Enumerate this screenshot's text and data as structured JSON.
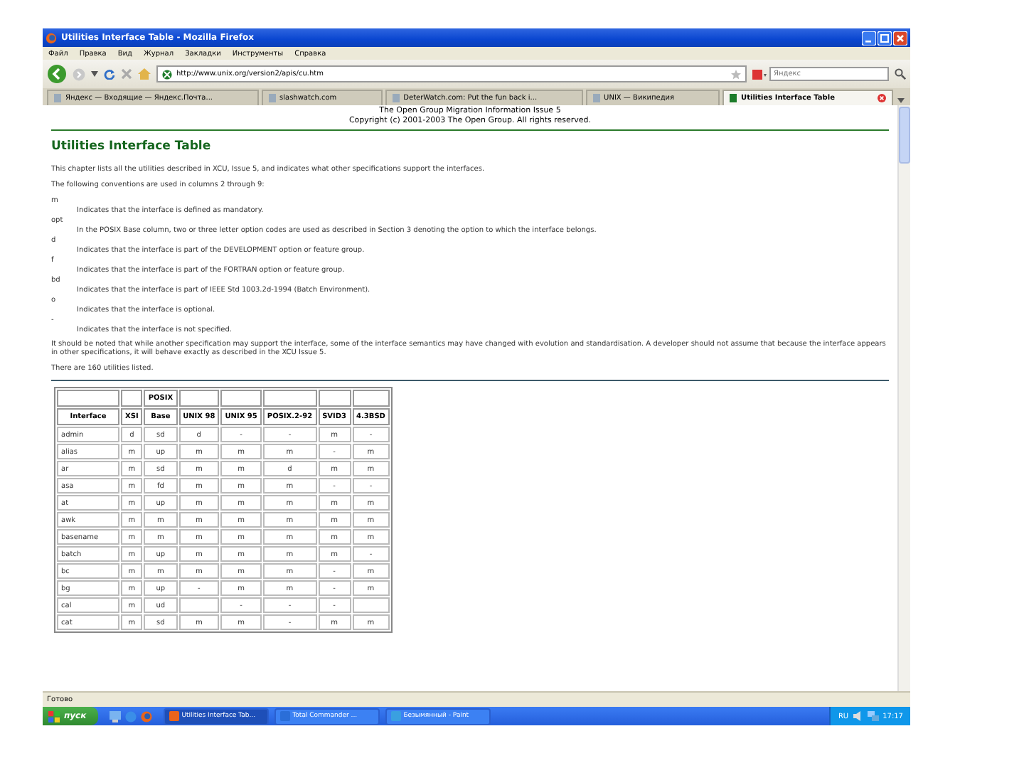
{
  "window": {
    "title": "Utilities Interface Table - Mozilla Firefox"
  },
  "menu": [
    "Файл",
    "Правка",
    "Вид",
    "Журнал",
    "Закладки",
    "Инструменты",
    "Справка"
  ],
  "toolbar": {
    "url": "http://www.unix.org/version2/apis/cu.htm",
    "search_placeholder": "Яндекс"
  },
  "tabs": [
    {
      "label": "Яндекс — Входящие — Яндекс.Почта...",
      "selected": false
    },
    {
      "label": "slashwatch.com",
      "selected": false
    },
    {
      "label": "DeterWatch.com: Put the fun back i...",
      "selected": false
    },
    {
      "label": "UNIX — Википедия",
      "selected": false
    },
    {
      "label": "Utilities Interface Table",
      "selected": true
    }
  ],
  "page": {
    "header": [
      "The Open Group Migration Information Issue 5",
      "Copyright (c) 2001-2003 The Open Group. All rights reserved."
    ],
    "heading": "Utilities Interface Table",
    "intro": [
      "This chapter lists all the utilities described in XCU, Issue 5, and indicates what other specifications support the interfaces.",
      "The following conventions are used in columns 2 through 9:"
    ],
    "conventions": [
      {
        "code": "m",
        "text": "Indicates that the interface is defined as mandatory."
      },
      {
        "code": "opt",
        "text": "In the POSIX Base column, two or three letter option codes are used as described in Section 3 denoting the option to which the interface belongs."
      },
      {
        "code": "d",
        "text": "Indicates that the interface is part of the DEVELOPMENT option or feature group."
      },
      {
        "code": "f",
        "text": "Indicates that the interface is part of the FORTRAN option or feature group."
      },
      {
        "code": "bd",
        "text": "Indicates that the interface is part of IEEE Std 1003.2d-1994 (Batch Environment)."
      },
      {
        "code": "o",
        "text": "Indicates that the interface is optional."
      },
      {
        "code": "-",
        "text": "Indicates that the interface is not specified."
      }
    ],
    "note": "It should be noted that while another specification may support the interface, some of the interface semantics may have changed with evolution and standardisation. A developer should not assume that because the interface appears in other specifications, it will behave exactly as described in the XCU Issue 5.",
    "count": "There are 160 utilities listed.",
    "table": {
      "group_header": "POSIX",
      "columns": [
        "Interface",
        "XSI",
        "Base",
        "UNIX 98",
        "UNIX 95",
        "POSIX.2-92",
        "SVID3",
        "4.3BSD"
      ],
      "rows": [
        [
          "admin",
          "d",
          "sd",
          "d",
          "-",
          "-",
          "m",
          "-"
        ],
        [
          "alias",
          "m",
          "up",
          "m",
          "m",
          "m",
          "-",
          "m"
        ],
        [
          "ar",
          "m",
          "sd",
          "m",
          "m",
          "d",
          "m",
          "m"
        ],
        [
          "asa",
          "m",
          "fd",
          "m",
          "m",
          "m",
          "-",
          "-"
        ],
        [
          "at",
          "m",
          "up",
          "m",
          "m",
          "m",
          "m",
          "m"
        ],
        [
          "awk",
          "m",
          "m",
          "m",
          "m",
          "m",
          "m",
          "m"
        ],
        [
          "basename",
          "m",
          "m",
          "m",
          "m",
          "m",
          "m",
          "m"
        ],
        [
          "batch",
          "m",
          "up",
          "m",
          "m",
          "m",
          "m",
          "-"
        ],
        [
          "bc",
          "m",
          "m",
          "m",
          "m",
          "m",
          "-",
          "m"
        ],
        [
          "bg",
          "m",
          "up",
          "-",
          "m",
          "m",
          "-",
          "m"
        ],
        [
          "cal",
          "m",
          "ud",
          "",
          "-",
          "-",
          "-",
          ""
        ],
        [
          "cat",
          "m",
          "sd",
          "m",
          "m",
          "-",
          "m",
          "m"
        ]
      ]
    }
  },
  "status_bar": "Готово",
  "taskbar": {
    "start": "пуск",
    "tasks": [
      {
        "label": "Utilities Interface Tab...",
        "selected": true
      },
      {
        "label": "Total Commander ...",
        "selected": false
      },
      {
        "label": "Безымянный - Paint",
        "selected": false
      }
    ],
    "language": "RU",
    "time": "17:17"
  }
}
